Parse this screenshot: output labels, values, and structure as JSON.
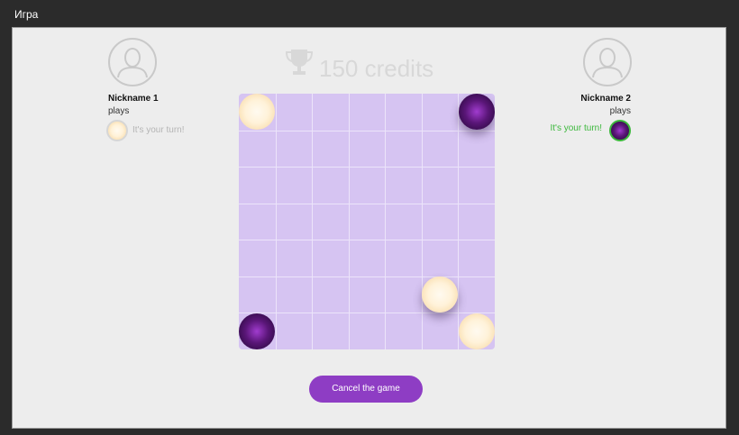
{
  "window": {
    "title": "Игра"
  },
  "credits": {
    "amount": "150 credits",
    "icon": "trophy-icon"
  },
  "player1": {
    "nickname": "Nickname 1",
    "status": "plays",
    "turn_text": "It's your turn!",
    "chip": "light",
    "active": false
  },
  "player2": {
    "nickname": "Nickname 2",
    "status": "plays",
    "turn_text": "It's your turn!",
    "chip": "dark",
    "active": true
  },
  "board": {
    "rows": 7,
    "cols": 7,
    "pieces": [
      {
        "row": 1,
        "col": 1,
        "color": "light",
        "lifted": false
      },
      {
        "row": 1,
        "col": 7,
        "color": "dark",
        "lifted": true
      },
      {
        "row": 6,
        "col": 6,
        "color": "light",
        "lifted": true
      },
      {
        "row": 7,
        "col": 1,
        "color": "dark",
        "lifted": false
      },
      {
        "row": 7,
        "col": 7,
        "color": "light",
        "lifted": false
      }
    ]
  },
  "actions": {
    "cancel_label": "Cancel the game"
  },
  "colors": {
    "accent": "#8e3dc4",
    "board": "#d6c4f2",
    "active_turn": "#3cb83c",
    "inactive_turn": "#b5b5b5"
  }
}
